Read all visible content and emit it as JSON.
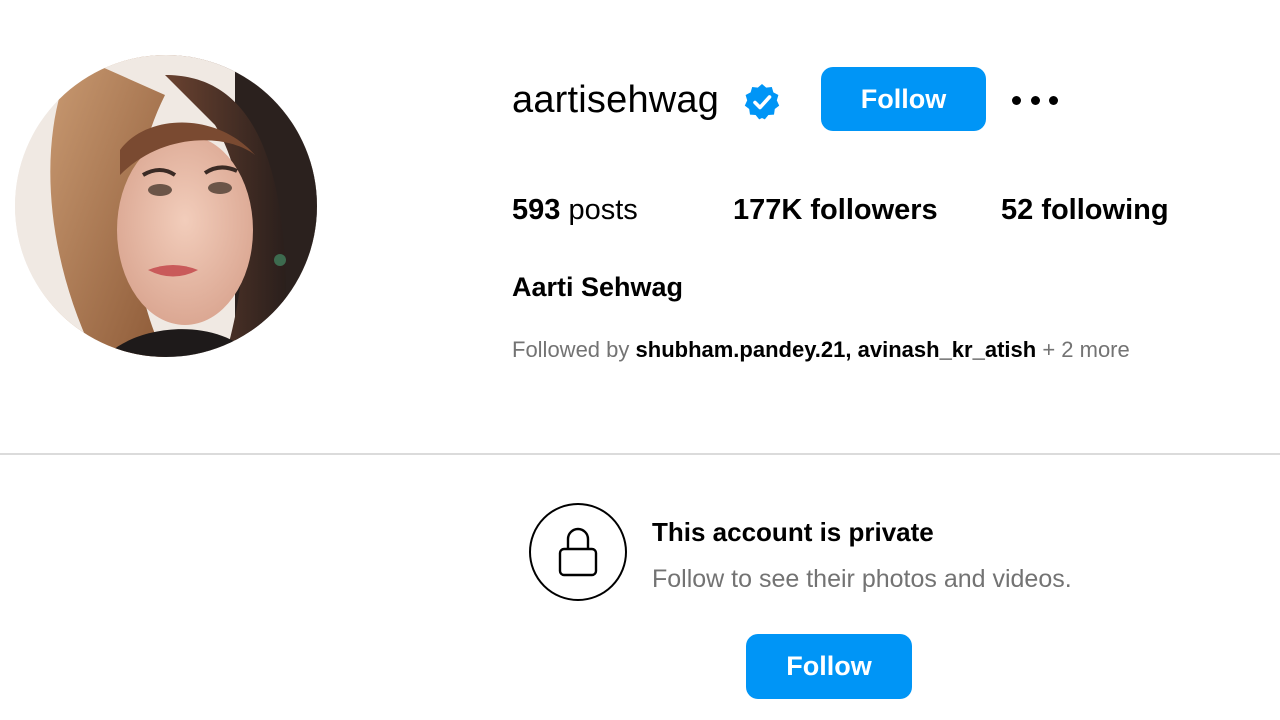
{
  "profile": {
    "username": "aartisehwag",
    "verified_icon": "verified-badge-icon",
    "follow_label": "Follow",
    "more_icon": "more-options-icon",
    "avatar_description_icon": "profile-photo",
    "full_name": "Aarti Sehwag"
  },
  "stats": {
    "posts_count": "593",
    "posts_label": "posts",
    "followers": "177K followers",
    "following": "52 following"
  },
  "followed_by": {
    "prefix": "Followed by",
    "names": [
      "shubham.pandey.21",
      "avinash_kr_atish"
    ],
    "separator": ",",
    "suffix": "+ 2 more"
  },
  "private_notice": {
    "icon": "lock-icon",
    "title": "This account is private",
    "subtitle": "Follow to see their photos and videos.",
    "follow_label": "Follow"
  },
  "colors": {
    "accent": "#0095f6",
    "secondary_text": "#737373",
    "divider": "#dbdbdb"
  }
}
